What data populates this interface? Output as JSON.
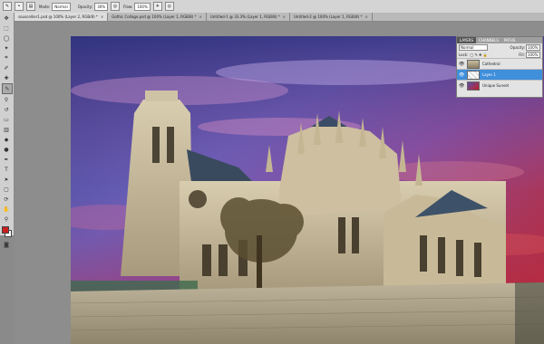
{
  "options_bar": {
    "mode_label": "Mode:",
    "mode_value": "Normal",
    "opacity_label": "Opacity:",
    "opacity_value": "30%",
    "flow_label": "Flow:",
    "flow_value": "100%"
  },
  "tabs": [
    {
      "label": "souscellier1.psd @ 100% (Layer 2, RGB/8) *"
    },
    {
      "label": "Gothic Collage.psd @ 100% (Layer 1, RGB/8) *"
    },
    {
      "label": "Untitled-1 @ 33.3% (Layer 1, RGB/8) *"
    },
    {
      "label": "Untitled-2 @ 100% (Layer 1, RGB/8) *"
    }
  ],
  "tab_close": "×",
  "colors": {
    "foreground": "#cc1f1f",
    "background": "#ffffff"
  },
  "layers_panel": {
    "tabs": [
      "LAYERS",
      "CHANNELS",
      "PATHS"
    ],
    "blend_mode": "Normal",
    "opacity_label": "Opacity:",
    "opacity_value": "100%",
    "lock_label": "Lock:",
    "fill_label": "Fill:",
    "fill_value": "100%",
    "layers": [
      {
        "name": "Cathedral",
        "active": false
      },
      {
        "name": "Layer 1",
        "active": true
      },
      {
        "name": "Unique Sunset",
        "active": false
      }
    ]
  }
}
